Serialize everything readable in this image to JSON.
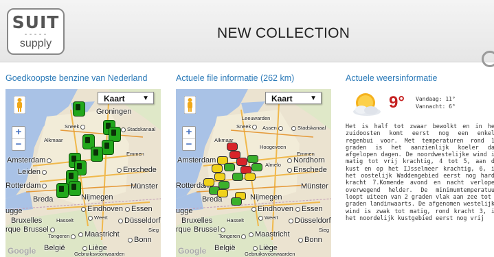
{
  "header": {
    "logo_line1": "SUIT",
    "logo_separator": "-----",
    "logo_line2": "supply",
    "title": "NEW COLLECTION"
  },
  "sections": {
    "fuel": {
      "title": "Goedkoopste benzine van Nederland"
    },
    "traffic": {
      "title": "Actuele file informatie (262 km)"
    },
    "weather": {
      "title": "Actuele weersinformatie"
    }
  },
  "map": {
    "type_select": "Kaart",
    "zoom_in": "+",
    "zoom_out": "−",
    "google": "Google",
    "cities": {
      "groningen": "Groningen",
      "leeuwarden": "Leeuwarden",
      "sneek": "Sneek",
      "assen": "Assen",
      "stadskanaal": "Stadskanaal",
      "alkmaar": "Alkmaar",
      "hoogeveen": "Hoogeveen",
      "emmen": "Emmen",
      "amsterdam": "Amsterdam",
      "almelo": "Almelo",
      "nordhorn": "Nordhorn",
      "leiden": "Leiden",
      "enschede": "Enschede",
      "rotterdam": "Rotterdam",
      "munster": "Münster",
      "breda": "Breda",
      "nijmegen": "Nijmegen",
      "eindhoven": "Eindhoven",
      "essen": "Essen",
      "brugge": "ugge",
      "bruxelles": "Bruxelles",
      "brussel": "Brussel",
      "hasselt": "Hasselt",
      "weert": "Weert",
      "dusseldorf": "Düsseldorf",
      "rque": "rque",
      "sieg": "Sieg",
      "tongeren": "Tongeren",
      "maastricht": "Maastricht",
      "bonn": "Bonn",
      "belgie": "België",
      "liege": "Liège",
      "gebruiksvoorwaarden": "Gebruiksvoorwaarden"
    }
  },
  "weather": {
    "temperature": "9°",
    "today_label": "Vandaag: 11°",
    "tonight_label": "Vannacht: 6°",
    "description": "Het is half tot zwaar bewolkt en in het zuidoosten komt eerst nog een enkele regenbui voor. Met temperaturen rond 11 graden is het aanzienlijk koeler dan afgelopen dagen. De noordwestelijke wind is matig tot vrij krachtig, 4 tot 5, aan de kust en op het IJsselmeer krachtig, 6, in het oostelijk Waddengebied eerst nog hard, kracht 7.Komende avond en nacht verlopen overwegend helder. De minimumtemperatuur loopt uiteen van 2 graden vlak aan zee tot 3 graden landinwaarts. De afgenomen westelijke wind is zwak tot matig, rond kracht 3, in het noordelijk kustgebied eerst nog vrij"
  },
  "colors": {
    "accent": "#2b7ab8",
    "temperature": "#c52020",
    "fuel_marker": "#22a81c",
    "traffic_yellow": "#f0d21a",
    "traffic_red": "#d8242a",
    "traffic_green": "#3bb02b"
  }
}
